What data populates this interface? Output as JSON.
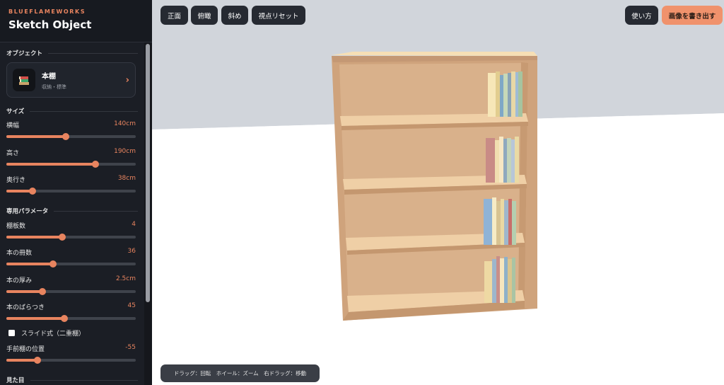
{
  "brand": {
    "eyebrow": "BLUEFLAMEWORKS",
    "title": "Sketch Object"
  },
  "sections": {
    "object": "オブジェクト",
    "size": "サイズ",
    "special": "専用パラメータ",
    "appearance": "見た目"
  },
  "object": {
    "name": "本棚",
    "category": "収納・標準",
    "icon": "books-icon",
    "chevron": "›"
  },
  "size_params": [
    {
      "label": "横幅",
      "value": "140cm",
      "level": 0.46
    },
    {
      "label": "高さ",
      "value": "190cm",
      "level": 0.69
    },
    {
      "label": "奥行き",
      "value": "38cm",
      "level": 0.2
    }
  ],
  "special_params": [
    {
      "label": "棚板数",
      "value": "4",
      "level": 0.43
    },
    {
      "label": "本の冊数",
      "value": "36",
      "level": 0.36
    },
    {
      "label": "本の厚み",
      "value": "2.5cm",
      "level": 0.28
    },
    {
      "label": "本のばらつき",
      "value": "45",
      "level": 0.45
    }
  ],
  "slide_option": {
    "label": "スライド式（二重棚）",
    "checked": false
  },
  "front_shelf": {
    "label": "手前棚の位置",
    "value": "-55",
    "level": 0.24
  },
  "toolbar": {
    "front": "正面",
    "top": "俯瞰",
    "oblique": "斜め",
    "reset": "視点リセット",
    "help": "使い方",
    "export": "画像を書き出す"
  },
  "help_text": "ドラッグ：回転　ホイール：ズーム　右ドラッグ：移動",
  "colors": {
    "accent": "#e8845f",
    "export_button": "#f0926c",
    "sidebar": "#1b1e25",
    "backdrop": "#d1d5db",
    "wood": "#d4ab83"
  }
}
